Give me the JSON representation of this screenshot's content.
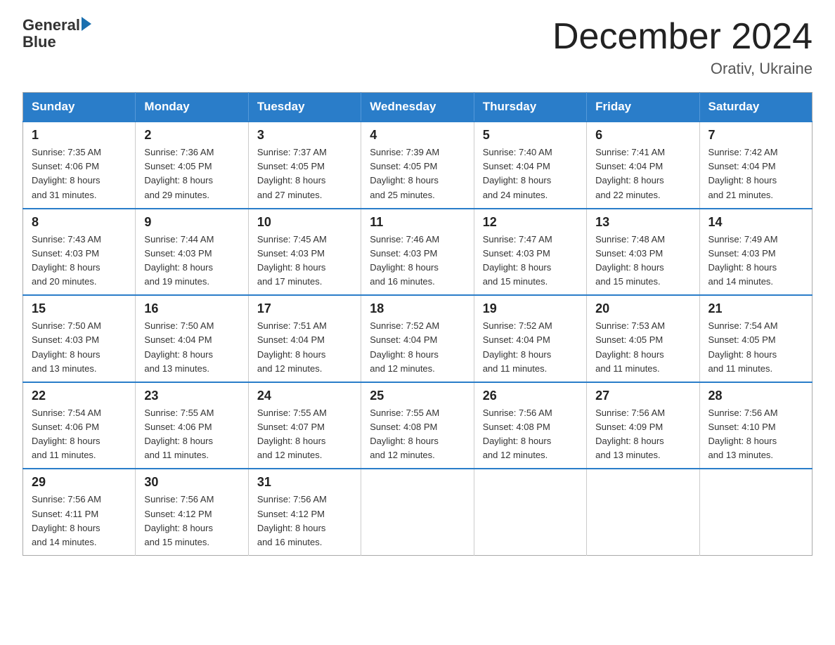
{
  "header": {
    "logo_general": "General",
    "logo_blue": "Blue",
    "month_title": "December 2024",
    "location": "Orativ, Ukraine"
  },
  "days_of_week": [
    "Sunday",
    "Monday",
    "Tuesday",
    "Wednesday",
    "Thursday",
    "Friday",
    "Saturday"
  ],
  "weeks": [
    [
      {
        "day": "1",
        "sunrise": "7:35 AM",
        "sunset": "4:06 PM",
        "daylight": "8 hours and 31 minutes."
      },
      {
        "day": "2",
        "sunrise": "7:36 AM",
        "sunset": "4:05 PM",
        "daylight": "8 hours and 29 minutes."
      },
      {
        "day": "3",
        "sunrise": "7:37 AM",
        "sunset": "4:05 PM",
        "daylight": "8 hours and 27 minutes."
      },
      {
        "day": "4",
        "sunrise": "7:39 AM",
        "sunset": "4:05 PM",
        "daylight": "8 hours and 25 minutes."
      },
      {
        "day": "5",
        "sunrise": "7:40 AM",
        "sunset": "4:04 PM",
        "daylight": "8 hours and 24 minutes."
      },
      {
        "day": "6",
        "sunrise": "7:41 AM",
        "sunset": "4:04 PM",
        "daylight": "8 hours and 22 minutes."
      },
      {
        "day": "7",
        "sunrise": "7:42 AM",
        "sunset": "4:04 PM",
        "daylight": "8 hours and 21 minutes."
      }
    ],
    [
      {
        "day": "8",
        "sunrise": "7:43 AM",
        "sunset": "4:03 PM",
        "daylight": "8 hours and 20 minutes."
      },
      {
        "day": "9",
        "sunrise": "7:44 AM",
        "sunset": "4:03 PM",
        "daylight": "8 hours and 19 minutes."
      },
      {
        "day": "10",
        "sunrise": "7:45 AM",
        "sunset": "4:03 PM",
        "daylight": "8 hours and 17 minutes."
      },
      {
        "day": "11",
        "sunrise": "7:46 AM",
        "sunset": "4:03 PM",
        "daylight": "8 hours and 16 minutes."
      },
      {
        "day": "12",
        "sunrise": "7:47 AM",
        "sunset": "4:03 PM",
        "daylight": "8 hours and 15 minutes."
      },
      {
        "day": "13",
        "sunrise": "7:48 AM",
        "sunset": "4:03 PM",
        "daylight": "8 hours and 15 minutes."
      },
      {
        "day": "14",
        "sunrise": "7:49 AM",
        "sunset": "4:03 PM",
        "daylight": "8 hours and 14 minutes."
      }
    ],
    [
      {
        "day": "15",
        "sunrise": "7:50 AM",
        "sunset": "4:03 PM",
        "daylight": "8 hours and 13 minutes."
      },
      {
        "day": "16",
        "sunrise": "7:50 AM",
        "sunset": "4:04 PM",
        "daylight": "8 hours and 13 minutes."
      },
      {
        "day": "17",
        "sunrise": "7:51 AM",
        "sunset": "4:04 PM",
        "daylight": "8 hours and 12 minutes."
      },
      {
        "day": "18",
        "sunrise": "7:52 AM",
        "sunset": "4:04 PM",
        "daylight": "8 hours and 12 minutes."
      },
      {
        "day": "19",
        "sunrise": "7:52 AM",
        "sunset": "4:04 PM",
        "daylight": "8 hours and 11 minutes."
      },
      {
        "day": "20",
        "sunrise": "7:53 AM",
        "sunset": "4:05 PM",
        "daylight": "8 hours and 11 minutes."
      },
      {
        "day": "21",
        "sunrise": "7:54 AM",
        "sunset": "4:05 PM",
        "daylight": "8 hours and 11 minutes."
      }
    ],
    [
      {
        "day": "22",
        "sunrise": "7:54 AM",
        "sunset": "4:06 PM",
        "daylight": "8 hours and 11 minutes."
      },
      {
        "day": "23",
        "sunrise": "7:55 AM",
        "sunset": "4:06 PM",
        "daylight": "8 hours and 11 minutes."
      },
      {
        "day": "24",
        "sunrise": "7:55 AM",
        "sunset": "4:07 PM",
        "daylight": "8 hours and 12 minutes."
      },
      {
        "day": "25",
        "sunrise": "7:55 AM",
        "sunset": "4:08 PM",
        "daylight": "8 hours and 12 minutes."
      },
      {
        "day": "26",
        "sunrise": "7:56 AM",
        "sunset": "4:08 PM",
        "daylight": "8 hours and 12 minutes."
      },
      {
        "day": "27",
        "sunrise": "7:56 AM",
        "sunset": "4:09 PM",
        "daylight": "8 hours and 13 minutes."
      },
      {
        "day": "28",
        "sunrise": "7:56 AM",
        "sunset": "4:10 PM",
        "daylight": "8 hours and 13 minutes."
      }
    ],
    [
      {
        "day": "29",
        "sunrise": "7:56 AM",
        "sunset": "4:11 PM",
        "daylight": "8 hours and 14 minutes."
      },
      {
        "day": "30",
        "sunrise": "7:56 AM",
        "sunset": "4:12 PM",
        "daylight": "8 hours and 15 minutes."
      },
      {
        "day": "31",
        "sunrise": "7:56 AM",
        "sunset": "4:12 PM",
        "daylight": "8 hours and 16 minutes."
      },
      null,
      null,
      null,
      null
    ]
  ],
  "labels": {
    "sunrise": "Sunrise:",
    "sunset": "Sunset:",
    "daylight": "Daylight:"
  }
}
